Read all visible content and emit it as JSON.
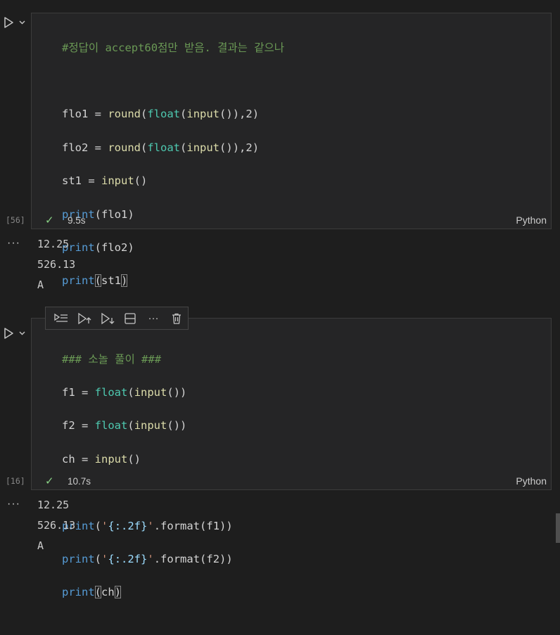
{
  "cells": [
    {
      "execution_count": "[56]",
      "duration": "9.5s",
      "language": "Python",
      "code_lines": [
        "#정답이 accept60점만 받음. 결과는 같으나",
        "",
        "flo1 = round(float(input()),2)",
        "flo2 = round(float(input()),2)",
        "st1 = input()",
        "print(flo1)",
        "print(flo2)",
        "print(st1)"
      ],
      "output": [
        "12.25",
        "526.13",
        "A"
      ]
    },
    {
      "execution_count": "[16]",
      "duration": "10.7s",
      "language": "Python",
      "code_lines": [
        "### 소놀 풀이 ###",
        "f1 = float(input())",
        "f2 = float(input())",
        "ch = input()",
        "",
        "print('{:.2f}'.format(f1))",
        "print('{:.2f}'.format(f2))",
        "print(ch)"
      ],
      "output": [
        "12.25",
        "526.13",
        "A"
      ]
    }
  ],
  "cell_toolbar": {
    "icons": [
      "run-by-line-icon",
      "execute-above-icon",
      "execute-below-icon",
      "split-cell-icon",
      "more-actions-icon",
      "delete-cell-icon"
    ],
    "more_label": "···"
  },
  "output_menu_label": "···",
  "check_mark": "✓",
  "colors": {
    "background": "#1e1e1e",
    "cell_background": "#252526",
    "comment": "#6a9955",
    "function": "#dcdcaa",
    "builtin_type": "#4ec9b0",
    "keyword": "#569cd6",
    "string": "#ce9178",
    "success_check": "#89d185"
  }
}
